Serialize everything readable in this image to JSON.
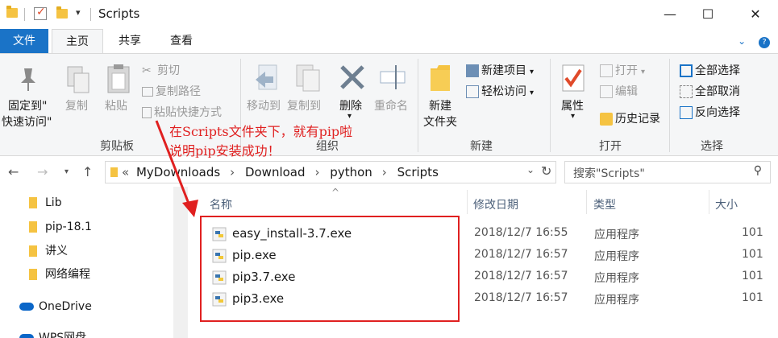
{
  "window": {
    "title": "Scripts",
    "controls": {
      "minimize": "—",
      "maximize": "☐",
      "close": "✕"
    }
  },
  "ribbon_tabs": {
    "file": "文件",
    "home": "主页",
    "share": "共享",
    "view": "查看"
  },
  "ribbon": {
    "clipboard": {
      "pin_line1": "固定到\"",
      "pin_line2": "快速访问\"",
      "copy": "复制",
      "paste": "粘贴",
      "cut": "剪切",
      "copy_path": "复制路径",
      "paste_shortcut": "粘贴快捷方式",
      "label": "剪贴板"
    },
    "organize": {
      "move_to": "移动到",
      "copy_to": "复制到",
      "delete": "删除",
      "rename": "重命名",
      "label": "组织"
    },
    "new": {
      "new_folder_line1": "新建",
      "new_folder_line2": "文件夹",
      "new_item": "新建项目",
      "easy_access": "轻松访问",
      "label": "新建"
    },
    "open": {
      "properties": "属性",
      "open": "打开",
      "edit": "编辑",
      "history": "历史记录",
      "label": "打开"
    },
    "select": {
      "select_all": "全部选择",
      "select_none": "全部取消",
      "invert": "反向选择",
      "label": "选择"
    }
  },
  "annotation": {
    "line1": "在Scripts文件夹下，就有pip啦",
    "line2": "说明pip安装成功！"
  },
  "address": {
    "prefix": "«",
    "crumbs": [
      "MyDownloads",
      "Download",
      "python",
      "Scripts"
    ],
    "search_placeholder": "搜索\"Scripts\""
  },
  "sidebar": {
    "items": [
      {
        "label": "Lib",
        "icon": "folder-icon"
      },
      {
        "label": "pip-18.1",
        "icon": "folder-icon"
      },
      {
        "label": "讲义",
        "icon": "folder-icon"
      },
      {
        "label": "网络编程",
        "icon": "folder-icon"
      },
      {
        "label": "OneDrive",
        "icon": "cloud-icon"
      },
      {
        "label": "WPS网盘",
        "icon": "cloud-icon"
      }
    ]
  },
  "columns": {
    "name": "名称",
    "date": "修改日期",
    "type": "类型",
    "size": "大小"
  },
  "files": [
    {
      "name": "easy_install-3.7.exe",
      "date": "2018/12/7 16:55",
      "type": "应用程序",
      "size": "101"
    },
    {
      "name": "pip.exe",
      "date": "2018/12/7 16:57",
      "type": "应用程序",
      "size": "101"
    },
    {
      "name": "pip3.7.exe",
      "date": "2018/12/7 16:57",
      "type": "应用程序",
      "size": "101"
    },
    {
      "name": "pip3.exe",
      "date": "2018/12/7 16:57",
      "type": "应用程序",
      "size": "101"
    }
  ],
  "colors": {
    "accent": "#1a73c7",
    "annotation": "#e02020",
    "folder": "#f5c342"
  }
}
